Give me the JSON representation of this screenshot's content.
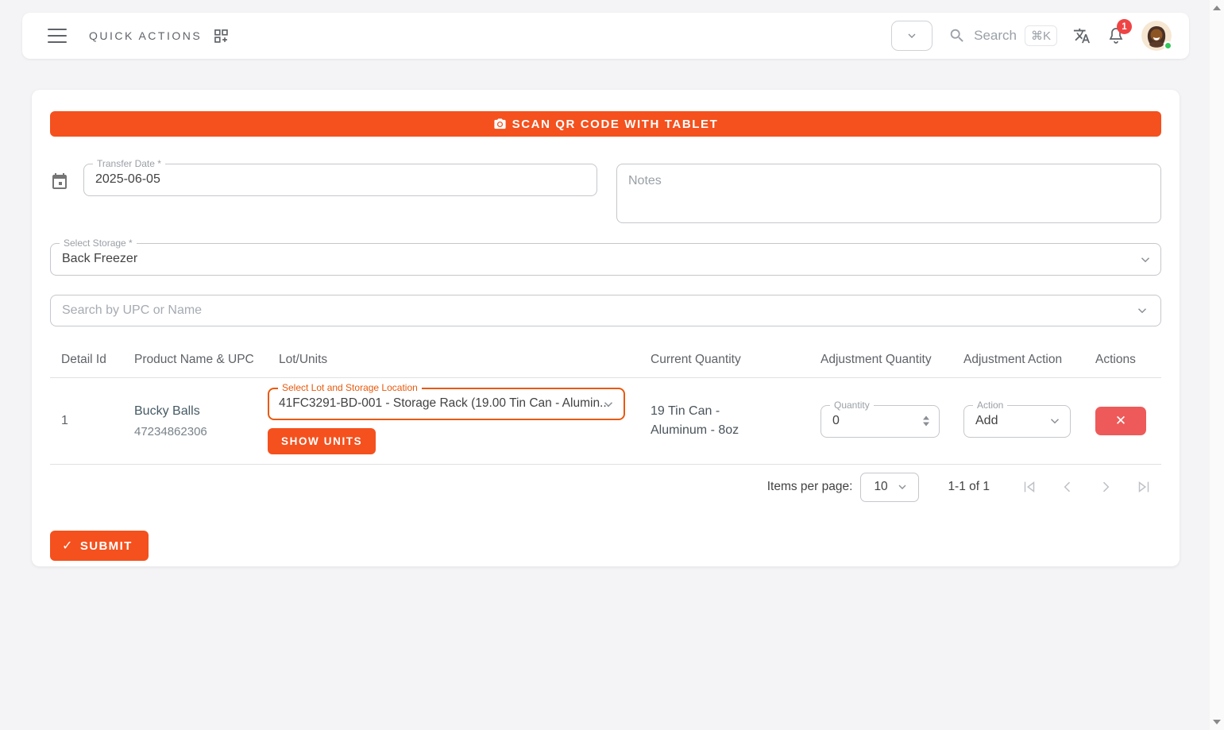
{
  "topbar": {
    "quick_actions_label": "QUICK ACTIONS",
    "search": {
      "placeholder": "Search",
      "shortcut": "⌘K"
    },
    "notification_count": "1"
  },
  "form": {
    "scan_button_label": "SCAN QR CODE WITH TABLET",
    "transfer_date": {
      "label": "Transfer Date *",
      "value": "2025-06-05"
    },
    "notes": {
      "placeholder": "Notes"
    },
    "storage": {
      "label": "Select Storage *",
      "value": "Back Freezer"
    },
    "product_search": {
      "placeholder": "Search by UPC or Name"
    }
  },
  "table": {
    "headers": [
      "Detail Id",
      "Product Name & UPC",
      "Lot/Units",
      "Current Quantity",
      "Adjustment Quantity",
      "Adjustment Action",
      "Actions"
    ],
    "rows": [
      {
        "detail_id": "1",
        "product_name": "Bucky Balls",
        "upc": "47234862306",
        "lot_select": {
          "label": "Select Lot and Storage Location",
          "value": "41FC3291-BD-001 - Storage Rack (19.00 Tin Can - Alumin..."
        },
        "show_units_label": "SHOW UNITS",
        "current_quantity": "19 Tin Can - Aluminum - 8oz",
        "quantity": {
          "label": "Quantity",
          "value": "0"
        },
        "action": {
          "label": "Action",
          "value": "Add"
        }
      }
    ]
  },
  "pagination": {
    "items_per_page_label": "Items per page:",
    "items_per_page_value": "10",
    "range_label": "1-1 of 1"
  },
  "submit_label": "SUBMIT",
  "icons": {
    "check": "✓",
    "close": "✕"
  },
  "colors": {
    "accent_orange": "#f4511e",
    "focus_orange": "#e8590c",
    "danger_red": "#ee5a5a",
    "badge_red": "#ef4444",
    "online_green": "#34c759"
  }
}
